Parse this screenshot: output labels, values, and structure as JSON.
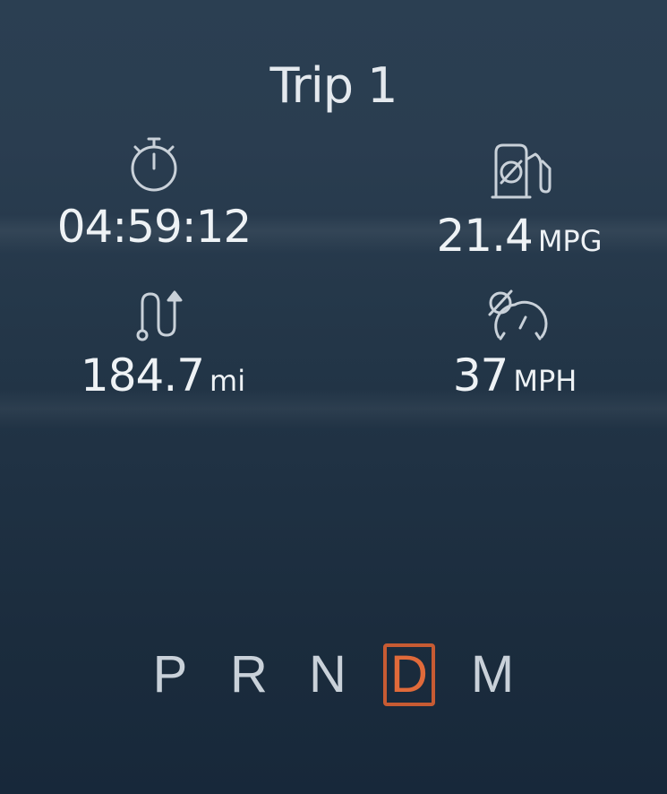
{
  "trip": {
    "title": "Trip 1"
  },
  "metrics": {
    "elapsed_time": {
      "value": "04:59:12",
      "icon": "stopwatch-icon"
    },
    "fuel_economy": {
      "value": "21.4",
      "unit": "MPG",
      "icon": "fuel-pump-average-icon"
    },
    "distance": {
      "value": "184.7",
      "unit": "mi",
      "icon": "route-distance-icon"
    },
    "average_speed": {
      "value": "37",
      "unit": "MPH",
      "icon": "average-speed-gauge-icon"
    }
  },
  "gear_selector": {
    "gears": [
      "P",
      "R",
      "N",
      "D",
      "M"
    ],
    "selected": "D"
  },
  "colors": {
    "active_gear": "#e06a3a",
    "text": "#e6ebf0",
    "background": "#22364a"
  }
}
